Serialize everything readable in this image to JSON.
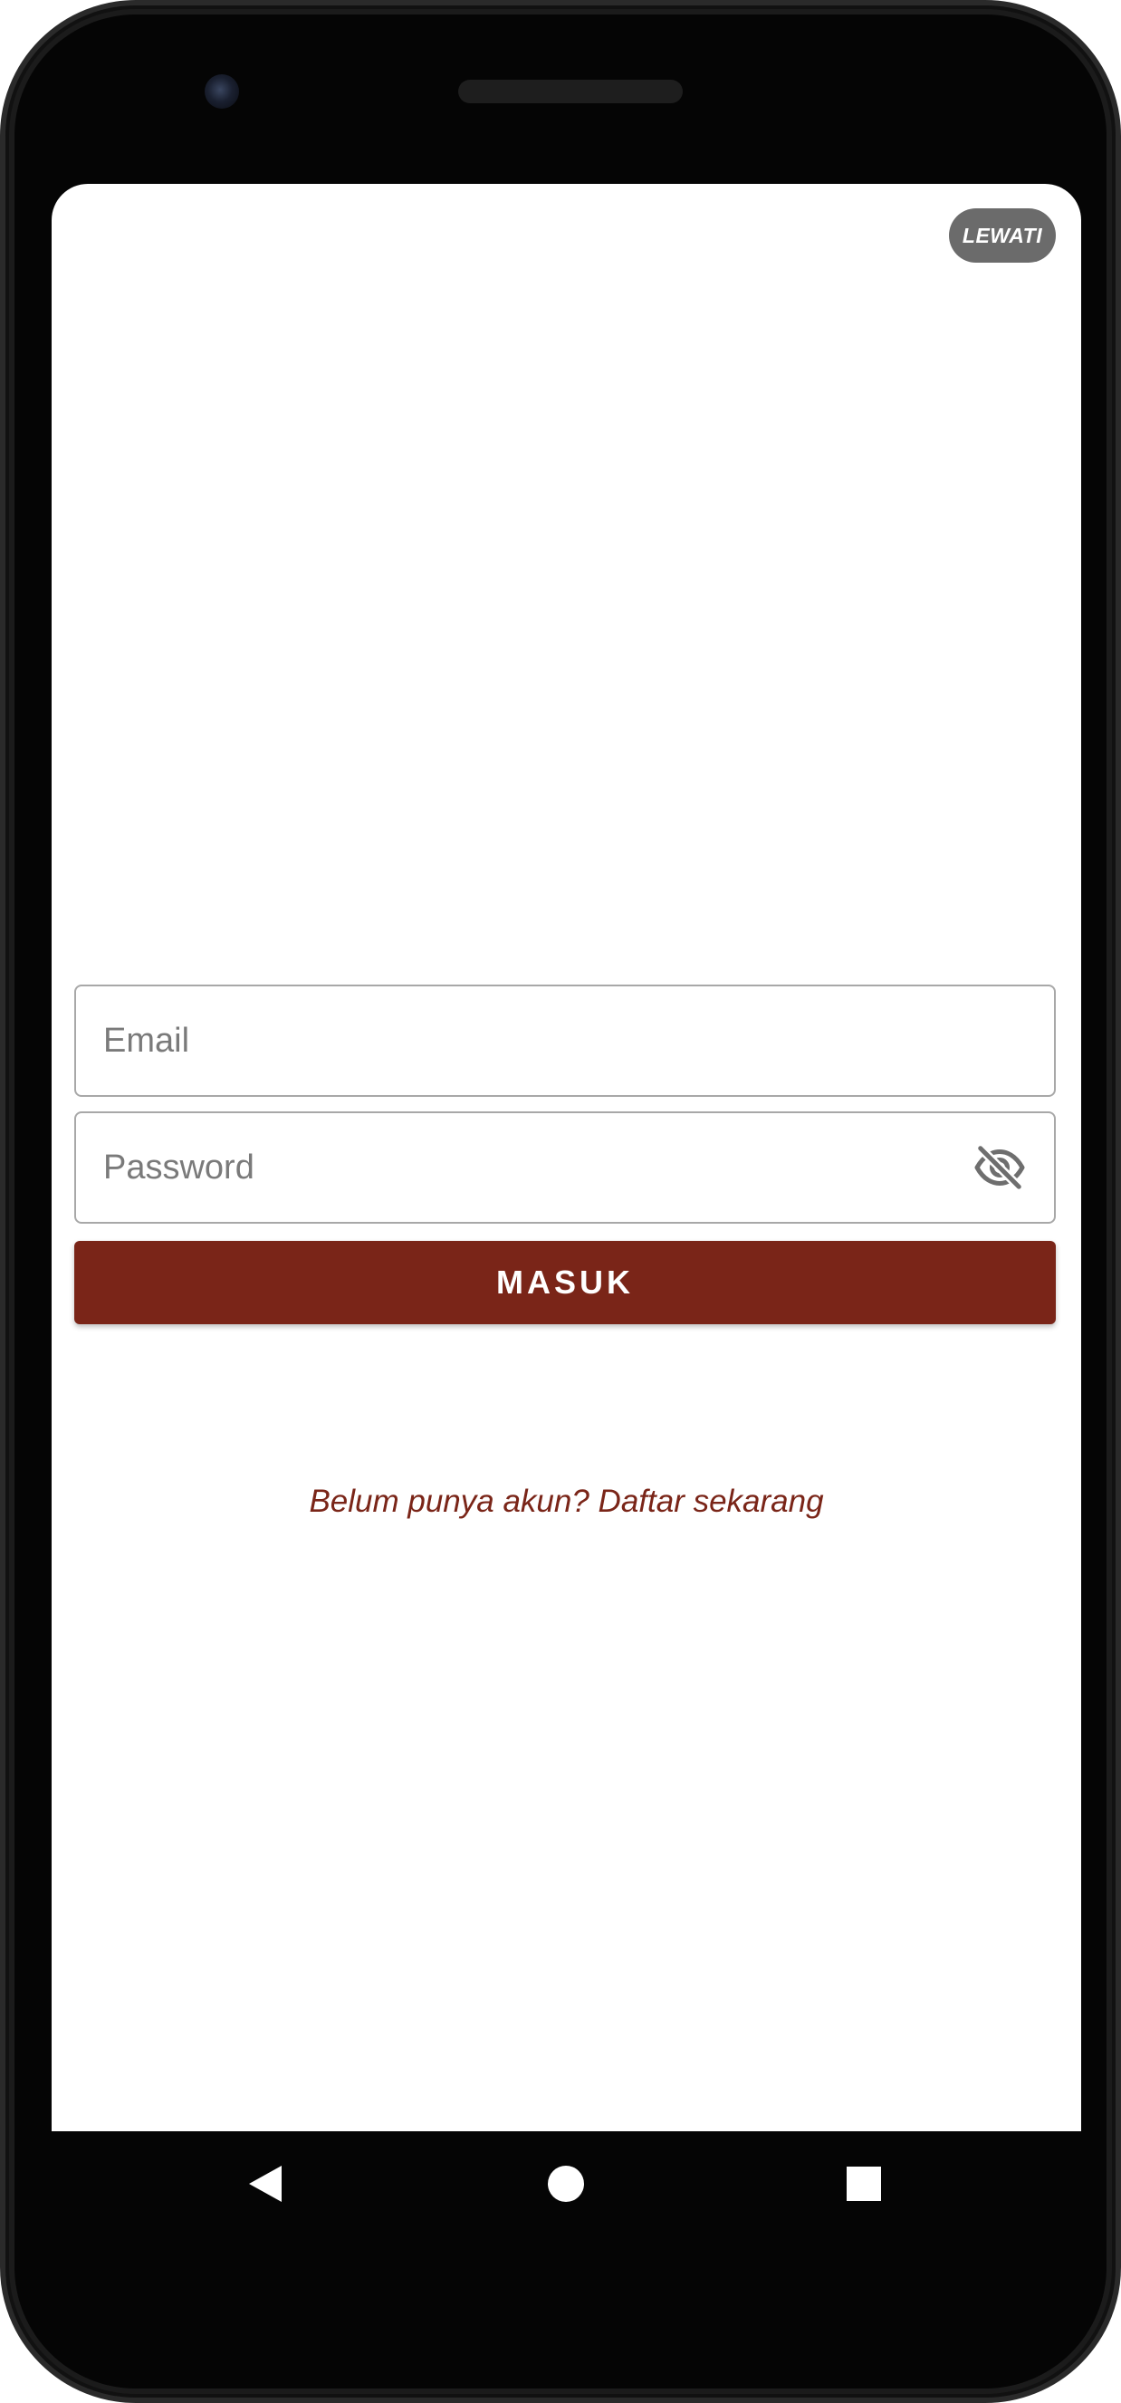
{
  "skip": {
    "label": "LEWATI"
  },
  "login_form": {
    "email": {
      "placeholder": "Email",
      "value": ""
    },
    "password": {
      "placeholder": "Password",
      "value": ""
    },
    "password_toggle_icon": "eye-off-icon",
    "submit_label": "MASUK"
  },
  "register_link": {
    "label": "Belum punya akun? Daftar sekarang"
  },
  "nav_bar": {
    "icons": [
      "back-triangle-icon",
      "home-circle-icon",
      "recents-square-icon"
    ]
  },
  "colors": {
    "accent": "#7a2518",
    "skip_bg": "#6b6b6b",
    "screen_bg": "#ffffff",
    "device_frame": "#050505"
  }
}
